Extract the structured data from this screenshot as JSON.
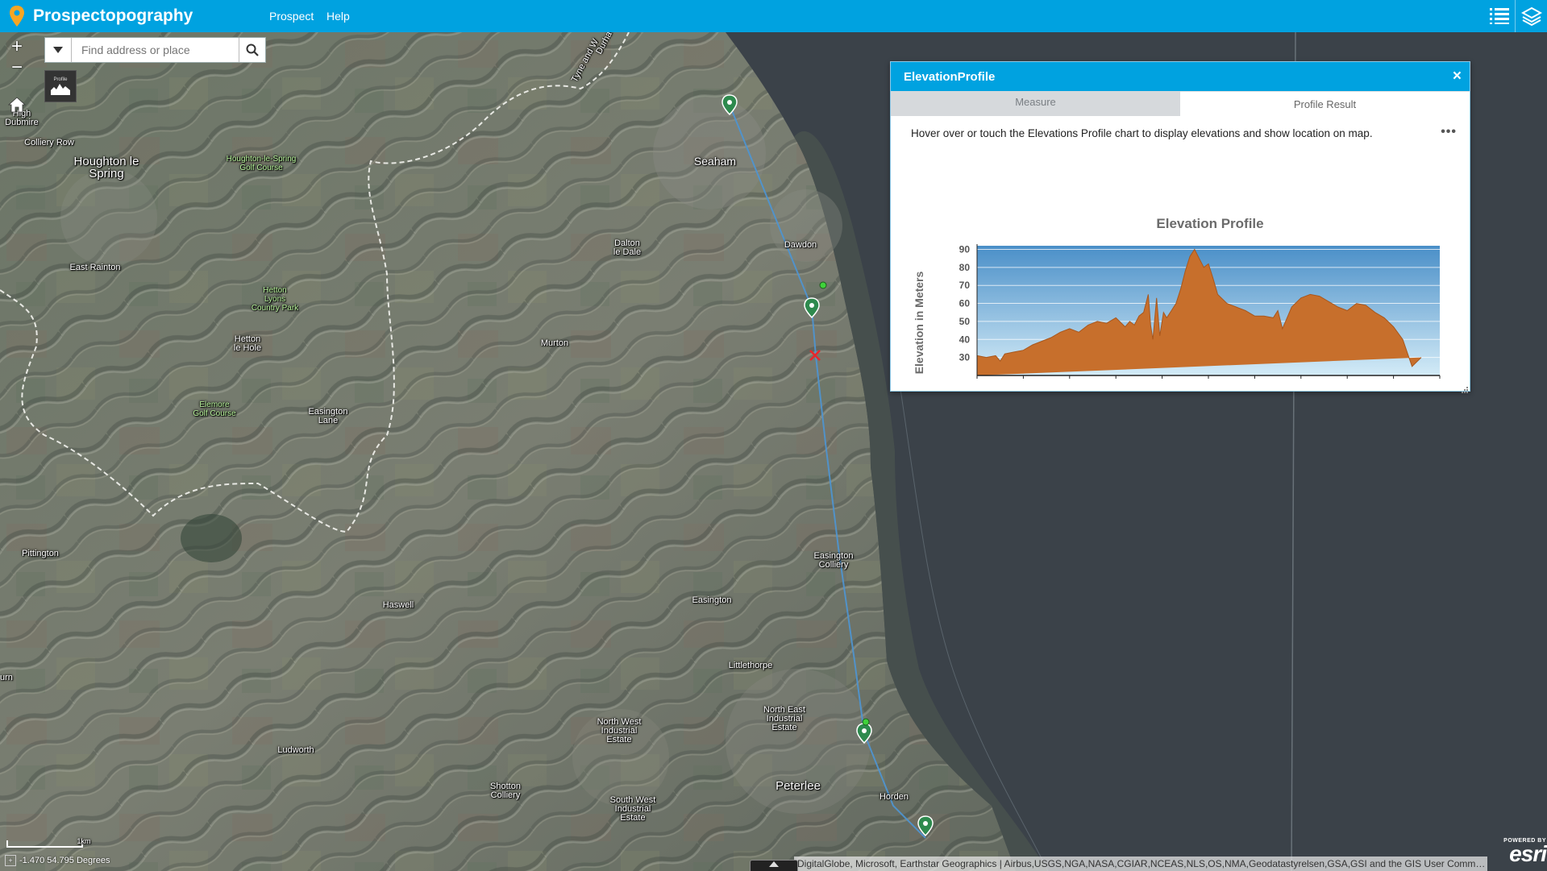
{
  "app": {
    "title": "Prospectopography",
    "menu": [
      "Prospect",
      "Help"
    ],
    "icons": {
      "app": "map-pin-icon",
      "legend": "list-icon",
      "layers": "layers-icon"
    }
  },
  "map_controls": {
    "zoom_in": "+",
    "zoom_out": "−",
    "search_placeholder": "Find address or place",
    "profile_tool_label": "Profile"
  },
  "places": [
    {
      "id": "high-dubmire",
      "text": "High\nDubmire"
    },
    {
      "id": "colliery-row",
      "text": "Colliery Row"
    },
    {
      "id": "houghton-le-spring",
      "text": "Houghton le\nSpring"
    },
    {
      "id": "houghton-golf",
      "text": "Houghton-le-Spring\nGolf Course"
    },
    {
      "id": "east-rainton",
      "text": "East Rainton"
    },
    {
      "id": "hetton-lyons",
      "text": "Hetton\nLyons\nCountry Park"
    },
    {
      "id": "hetton-le-hole",
      "text": "Hetton\nle Hole"
    },
    {
      "id": "elemore-golf",
      "text": "Elemore\nGolf Course"
    },
    {
      "id": "easington-lane",
      "text": "Easington\nLane"
    },
    {
      "id": "seaham",
      "text": "Seaham"
    },
    {
      "id": "dalton-le-dale",
      "text": "Dalton\nle Dale"
    },
    {
      "id": "dawdon",
      "text": "Dawdon"
    },
    {
      "id": "murton",
      "text": "Murton"
    },
    {
      "id": "pittington",
      "text": "Pittington"
    },
    {
      "id": "haswell",
      "text": "Haswell"
    },
    {
      "id": "easington",
      "text": "Easington"
    },
    {
      "id": "easington-colliery",
      "text": "Easington\nColliery"
    },
    {
      "id": "littlethorpe",
      "text": "Littlethorpe"
    },
    {
      "id": "north-east-industrial",
      "text": "North East\nIndustrial\nEstate"
    },
    {
      "id": "north-west-industrial",
      "text": "North West\nIndustrial\nEstate"
    },
    {
      "id": "ludworth",
      "text": "Ludworth"
    },
    {
      "id": "shotton-colliery",
      "text": "Shotton\nColliery"
    },
    {
      "id": "south-west-industrial",
      "text": "South West\nIndustrial\nEstate"
    },
    {
      "id": "peterlee",
      "text": "Peterlee"
    },
    {
      "id": "horden",
      "text": "Horden"
    },
    {
      "id": "road-label",
      "text": "Tyne and W"
    },
    {
      "id": "road-label-2",
      "text": "Durha"
    },
    {
      "id": "edge-label",
      "text": "urn"
    }
  ],
  "bottom": {
    "scale_label": "1km",
    "coordinates": "-1.470 54.795 Degrees",
    "attribution": "DigitalGlobe, Microsoft, Earthstar Geographics | Airbus,USGS,NGA,NASA,CGIAR,NCEAS,NLS,OS,NMA,Geodatastyrelsen,GSA,GSI and the GIS User Community",
    "powered_by": "POWERED BY",
    "esri": "esri"
  },
  "panel": {
    "title": "ElevationProfile",
    "close": "×",
    "tabs": [
      {
        "label": "Measure",
        "active": false
      },
      {
        "label": "Profile Result",
        "active": true
      }
    ],
    "hint": "Hover over or touch the Elevations Profile chart to display elevations and show location on map.",
    "more": "•••"
  },
  "chart_data": {
    "type": "area",
    "title": "Elevation Profile",
    "ylabel": "Elevation in Meters",
    "xlabel": "",
    "yticks": [
      30,
      40,
      50,
      60,
      70,
      80,
      90
    ],
    "ylim": [
      20,
      92
    ],
    "xlim": [
      0,
      100
    ],
    "fill_color": "#c76f2c",
    "sky_top_color": "#4a8fc8",
    "sky_bottom_color": "#d3ebf7",
    "x": [
      0,
      2,
      4,
      5,
      6,
      8,
      10,
      12,
      14,
      16,
      18,
      20,
      22,
      24,
      26,
      28,
      30,
      32,
      33,
      34,
      35,
      36,
      37,
      37.5,
      38,
      38.8,
      39.5,
      40.3,
      41,
      42,
      43,
      44,
      45,
      46,
      47,
      48,
      49,
      50,
      51,
      52,
      54,
      56,
      58,
      60,
      62,
      64,
      65,
      66,
      67,
      68,
      70,
      72,
      74,
      76,
      78,
      80,
      82,
      84,
      86,
      88,
      90,
      92,
      94,
      96,
      98,
      99,
      100
    ],
    "y": [
      31,
      30,
      31,
      28,
      32,
      33,
      34,
      37,
      39,
      41,
      44,
      46,
      44,
      48,
      50,
      49,
      52,
      47,
      50,
      48,
      53,
      55,
      65,
      48,
      40,
      63,
      42,
      55,
      52,
      56,
      60,
      68,
      78,
      86,
      90,
      85,
      80,
      82,
      74,
      65,
      60,
      58,
      56,
      53,
      53,
      52,
      56,
      46,
      52,
      58,
      63,
      65,
      64,
      61,
      58,
      56,
      60,
      59,
      55,
      52,
      47,
      40,
      25,
      30
    ]
  }
}
